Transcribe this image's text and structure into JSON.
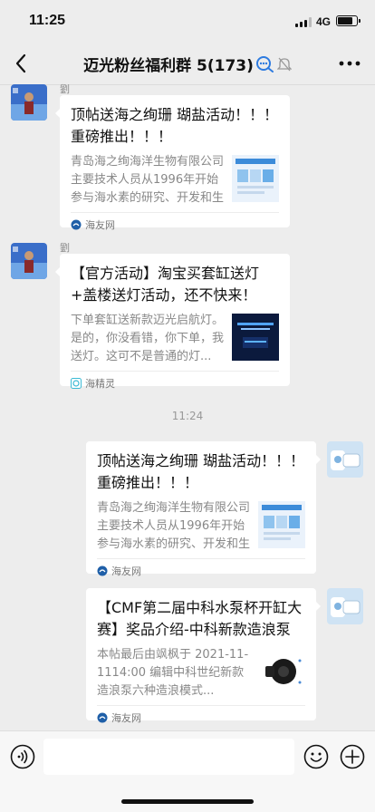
{
  "status": {
    "time": "11:25",
    "network": "4G",
    "battery_level": 0.85
  },
  "nav": {
    "title": "迈光粉丝福利群 5(173)",
    "back_icon": "back-arrow-icon",
    "more_icon": "more-dots-icon"
  },
  "messages": [
    {
      "side": "left",
      "sender": "劉",
      "title": "顶帖送海之绚珊 瑚盐活动！！！ 重磅推出！！！",
      "desc": "青岛海之绚海洋生物有限公司主要技术人员从1996年开始参与海水素的研究、开发和生产工作...",
      "source": "海友网",
      "source_icon": "hiyou-logo-icon"
    },
    {
      "side": "left",
      "sender": "劉",
      "title": "【官方活动】淘宝买套缸送灯+盖楼送灯活动，还不快来！",
      "desc": "下单套缸送新款迈光启航灯。是的，你没看错，你下单，我送灯。这可不是普通的灯...",
      "source": "海精灵",
      "source_icon": "haijingling-logo-icon"
    },
    {
      "side": "right",
      "title": "顶帖送海之绚珊 瑚盐活动！！！ 重磅推出！！！",
      "desc": "青岛海之绚海洋生物有限公司主要技术人员从1996年开始参与海水素的研究、开发和生产工作...",
      "source": "海友网",
      "source_icon": "hiyou-logo-icon"
    },
    {
      "side": "right",
      "title": "【CMF第二届中科水泵杯开缸大赛】奖品介绍-中科新款造浪泵",
      "desc": "本帖最后由飒枫于 2021-11-1114:00 编辑中科世纪新款造浪泵六种造浪模式...",
      "source": "海友网",
      "source_icon": "hiyou-logo-icon"
    }
  ],
  "timestamp_divider": "11:24",
  "input_bar": {
    "voice_icon": "voice-icon",
    "emoji_icon": "emoji-icon",
    "plus_icon": "plus-icon"
  },
  "colors": {
    "background": "#ededed",
    "card": "#ffffff",
    "accent_blue": "#2d7be0"
  }
}
